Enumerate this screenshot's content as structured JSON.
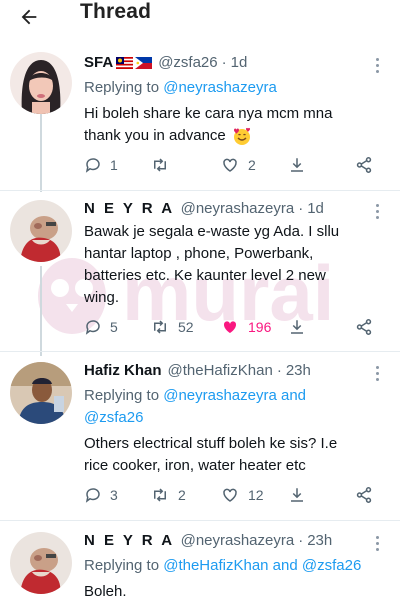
{
  "header": {
    "title": "Thread"
  },
  "tweets": [
    {
      "name": "SFA",
      "handle": "@zsfa26",
      "time": "1d",
      "replying_prefix": "Replying to",
      "replying_to": "@neyrashazeyra",
      "replying_suffix": "",
      "text_lines": [
        "Hi boleh share ke cara nya mcm mna",
        "thank you in advance"
      ],
      "emoji": "smiling-face-with-hearts",
      "reply_count": "1",
      "retweet_count": "",
      "like_count": "2",
      "liked": false
    },
    {
      "name": "N E Y R A",
      "handle": "@neyrashazeyra",
      "time": "1d",
      "text_lines": [
        "Bawak je segala e-waste yg Ada. I sllu",
        "hantar laptop , phone, Powerbank,",
        "batteries etc. Ke kaunter level 2 new",
        "wing."
      ],
      "reply_count": "5",
      "retweet_count": "52",
      "like_count": "196",
      "liked": true
    },
    {
      "name": "Hafiz Khan",
      "handle": "@theHafizKhan",
      "time": "23h",
      "replying_prefix": "Replying to",
      "replying_to": "@neyrashazeyra and",
      "replying_to_2": "@zsfa26",
      "text_lines": [
        "Others electrical stuff boleh ke sis? I.e",
        "rice cooker, iron, water heater etc"
      ],
      "reply_count": "3",
      "retweet_count": "2",
      "like_count": "12",
      "liked": false
    },
    {
      "name": "N E Y R A",
      "handle": "@neyrashazeyra",
      "time": "23h",
      "replying_prefix": "Replying to",
      "replying_to": "@theHafizKhan and @zsfa26",
      "text_lines": [
        "Boleh."
      ]
    }
  ],
  "watermark": {
    "text": "murai"
  },
  "colors": {
    "link": "#1d9bf0",
    "muted": "#536471",
    "like": "#f91880",
    "watermark": "#f3dde9"
  }
}
